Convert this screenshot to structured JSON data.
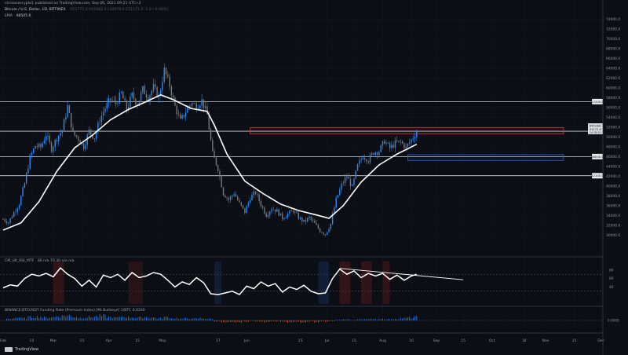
{
  "header": {
    "publisher": "chrisonecrypto1 published on TradingView.com, Sep 06, 2021 09:21 UTC+2",
    "symbol": "Bitcoin / U.S. Dollar, 1D, BITFINEX",
    "ohlc": "O51775.0 H51962.0 L50978.0 C51171.0 -1.0 (-0.00%)",
    "ema_label": "EMA",
    "ema_value": "48505.6"
  },
  "indicators": {
    "rsi_label": "CM_Ult_RSI_MTF",
    "rsi_params": "66 n/a 70 30 n/a n/a",
    "fund_label": "BINANCE:BTCUSDT Funding Rate (Premium Index) [Mr.Bullseye] 1/BTC 0.0100"
  },
  "footer": {
    "brand": "TradingView"
  },
  "colors": {
    "background": "#0c0e15",
    "up": "#2a8bf2",
    "down": "#777777",
    "ema": "#ffffff",
    "resistance_box": "#d43a3a",
    "support_box": "#2f5cc8",
    "level_line": "#cfd3da"
  },
  "chart_data": {
    "type": "candlestick",
    "x_ticks": [
      "Feb",
      "15",
      "Mar",
      "15",
      "Apr",
      "15",
      "May",
      "17",
      "Jun",
      "15",
      "Jul",
      "15",
      "Aug",
      "16",
      "Sep",
      "15",
      "Oct",
      "18",
      "Nov",
      "15",
      "Dec",
      "15"
    ],
    "y_ticks": [
      30000,
      32000,
      34000,
      36000,
      38000,
      40000,
      42000,
      44000,
      46000,
      48000,
      50000,
      52000,
      54000,
      56000,
      58000,
      60000,
      62000,
      64000,
      66000,
      68000,
      70000,
      72000,
      74000
    ],
    "ylim": [
      27000,
      76000
    ],
    "horizontal_levels": [
      57200.0,
      51171.0,
      46000.0,
      42100.0
    ],
    "level_labels": [
      "57200.0",
      "46000.0",
      "42100.0"
    ],
    "current_price_label": "BTCUSD",
    "current_price": "51171.0",
    "current_time_label": "14:38:51",
    "resistance_zone": [
      50600,
      51900
    ],
    "support_zone": [
      45200,
      46400
    ],
    "close_path": [
      [
        0,
        33200
      ],
      [
        3,
        32600
      ],
      [
        6,
        34600
      ],
      [
        9,
        36400
      ],
      [
        12,
        40500
      ],
      [
        15,
        45800
      ],
      [
        18,
        48200
      ],
      [
        21,
        47900
      ],
      [
        24,
        50500
      ],
      [
        27,
        47600
      ],
      [
        30,
        49800
      ],
      [
        33,
        51400
      ],
      [
        36,
        56200
      ],
      [
        39,
        50700
      ],
      [
        42,
        49700
      ],
      [
        45,
        48000
      ],
      [
        48,
        51200
      ],
      [
        51,
        49800
      ],
      [
        54,
        53600
      ],
      [
        57,
        55900
      ],
      [
        60,
        57600
      ],
      [
        63,
        56800
      ],
      [
        66,
        58900
      ],
      [
        69,
        55600
      ],
      [
        72,
        58500
      ],
      [
        75,
        56700
      ],
      [
        78,
        59700
      ],
      [
        81,
        58100
      ],
      [
        84,
        60100
      ],
      [
        87,
        58100
      ],
      [
        90,
        63600
      ],
      [
        93,
        60500
      ],
      [
        96,
        56200
      ],
      [
        99,
        53200
      ],
      [
        102,
        55200
      ],
      [
        105,
        57000
      ],
      [
        108,
        56300
      ],
      [
        111,
        57400
      ],
      [
        114,
        54500
      ],
      [
        117,
        46500
      ],
      [
        120,
        43600
      ],
      [
        123,
        38500
      ],
      [
        126,
        37200
      ],
      [
        129,
        38600
      ],
      [
        132,
        36400
      ],
      [
        135,
        34700
      ],
      [
        138,
        37600
      ],
      [
        141,
        38700
      ],
      [
        144,
        36200
      ],
      [
        147,
        34100
      ],
      [
        150,
        35500
      ],
      [
        153,
        34900
      ],
      [
        156,
        33500
      ],
      [
        159,
        34300
      ],
      [
        162,
        35000
      ],
      [
        165,
        33600
      ],
      [
        168,
        32700
      ],
      [
        171,
        33500
      ],
      [
        174,
        32300
      ],
      [
        177,
        30900
      ],
      [
        180,
        30200
      ],
      [
        183,
        32300
      ],
      [
        186,
        37200
      ],
      [
        189,
        40100
      ],
      [
        192,
        42000
      ],
      [
        195,
        39700
      ],
      [
        198,
        44100
      ],
      [
        201,
        46200
      ],
      [
        204,
        45300
      ],
      [
        207,
        46900
      ],
      [
        210,
        47100
      ],
      [
        213,
        49200
      ],
      [
        216,
        47700
      ],
      [
        219,
        48700
      ],
      [
        222,
        49000
      ],
      [
        225,
        47800
      ],
      [
        228,
        49400
      ],
      [
        231,
        51171
      ]
    ],
    "ema_path": [
      [
        0,
        31000
      ],
      [
        10,
        32500
      ],
      [
        20,
        36800
      ],
      [
        30,
        43000
      ],
      [
        40,
        47800
      ],
      [
        50,
        50400
      ],
      [
        60,
        53500
      ],
      [
        70,
        55600
      ],
      [
        80,
        57200
      ],
      [
        88,
        58600
      ],
      [
        95,
        57600
      ],
      [
        105,
        55800
      ],
      [
        114,
        55200
      ],
      [
        118,
        52400
      ],
      [
        125,
        46500
      ],
      [
        135,
        41000
      ],
      [
        145,
        38500
      ],
      [
        155,
        36300
      ],
      [
        165,
        35000
      ],
      [
        175,
        34100
      ],
      [
        182,
        33400
      ],
      [
        190,
        36000
      ],
      [
        200,
        40800
      ],
      [
        210,
        44300
      ],
      [
        220,
        46500
      ],
      [
        231,
        48505
      ]
    ],
    "rsi": {
      "ylim": [
        0,
        100
      ],
      "overbought": 70,
      "oversold": 30,
      "tick_labels": [
        "80",
        "60",
        "40"
      ],
      "values": [
        [
          0,
          38
        ],
        [
          4,
          45
        ],
        [
          8,
          42
        ],
        [
          12,
          60
        ],
        [
          16,
          70
        ],
        [
          20,
          66
        ],
        [
          24,
          72
        ],
        [
          28,
          64
        ],
        [
          32,
          85
        ],
        [
          36,
          70
        ],
        [
          40,
          60
        ],
        [
          44,
          42
        ],
        [
          48,
          56
        ],
        [
          52,
          40
        ],
        [
          56,
          68
        ],
        [
          60,
          62
        ],
        [
          64,
          70
        ],
        [
          68,
          56
        ],
        [
          72,
          74
        ],
        [
          76,
          62
        ],
        [
          80,
          66
        ],
        [
          84,
          74
        ],
        [
          88,
          70
        ],
        [
          92,
          56
        ],
        [
          96,
          40
        ],
        [
          100,
          52
        ],
        [
          104,
          46
        ],
        [
          108,
          62
        ],
        [
          112,
          50
        ],
        [
          116,
          24
        ],
        [
          120,
          22
        ],
        [
          124,
          26
        ],
        [
          128,
          30
        ],
        [
          132,
          22
        ],
        [
          136,
          42
        ],
        [
          140,
          36
        ],
        [
          144,
          52
        ],
        [
          148,
          42
        ],
        [
          152,
          48
        ],
        [
          156,
          28
        ],
        [
          160,
          40
        ],
        [
          164,
          34
        ],
        [
          168,
          44
        ],
        [
          172,
          30
        ],
        [
          176,
          24
        ],
        [
          180,
          26
        ],
        [
          184,
          60
        ],
        [
          188,
          82
        ],
        [
          192,
          70
        ],
        [
          196,
          78
        ],
        [
          200,
          62
        ],
        [
          204,
          72
        ],
        [
          208,
          66
        ],
        [
          212,
          72
        ],
        [
          216,
          58
        ],
        [
          220,
          68
        ],
        [
          224,
          56
        ],
        [
          228,
          66
        ],
        [
          231,
          70
        ]
      ],
      "trendline": [
        [
          188,
          84
        ],
        [
          257,
          57
        ]
      ]
    },
    "funding": {
      "zero_label": "0.0000",
      "bars": [
        [
          2,
          0.3
        ],
        [
          6,
          0.5
        ],
        [
          10,
          0.4
        ],
        [
          14,
          0.6
        ],
        [
          18,
          0.7
        ],
        [
          22,
          0.5
        ],
        [
          26,
          0.6
        ],
        [
          30,
          0.8
        ],
        [
          34,
          0.9
        ],
        [
          38,
          0.7
        ],
        [
          42,
          0.5
        ],
        [
          46,
          0.6
        ],
        [
          50,
          0.7
        ],
        [
          54,
          0.8
        ],
        [
          58,
          0.6
        ],
        [
          62,
          0.5
        ],
        [
          66,
          0.7
        ],
        [
          70,
          0.6
        ],
        [
          74,
          0.5
        ],
        [
          78,
          0.6
        ],
        [
          82,
          0.5
        ],
        [
          86,
          0.4
        ],
        [
          90,
          0.6
        ],
        [
          94,
          0.4
        ],
        [
          98,
          0.3
        ],
        [
          102,
          0.4
        ],
        [
          106,
          0.3
        ],
        [
          110,
          0.4
        ],
        [
          114,
          0.3
        ],
        [
          118,
          -0.2
        ],
        [
          122,
          -0.3
        ],
        [
          126,
          -0.2
        ],
        [
          130,
          -0.3
        ],
        [
          134,
          -0.2
        ],
        [
          138,
          -0.1
        ],
        [
          142,
          -0.2
        ],
        [
          146,
          -0.3
        ],
        [
          150,
          -0.2
        ],
        [
          154,
          -0.2
        ],
        [
          158,
          -0.3
        ],
        [
          162,
          -0.2
        ],
        [
          166,
          -0.3
        ],
        [
          170,
          -0.2
        ],
        [
          174,
          -0.3
        ],
        [
          178,
          -0.2
        ],
        [
          182,
          -0.1
        ],
        [
          186,
          0.1
        ],
        [
          190,
          0.2
        ],
        [
          194,
          0.1
        ],
        [
          198,
          0.2
        ],
        [
          202,
          0.3
        ],
        [
          206,
          0.2
        ],
        [
          210,
          0.3
        ],
        [
          214,
          0.2
        ],
        [
          218,
          0.3
        ],
        [
          222,
          0.4
        ],
        [
          226,
          0.5
        ],
        [
          230,
          0.6
        ]
      ]
    }
  }
}
